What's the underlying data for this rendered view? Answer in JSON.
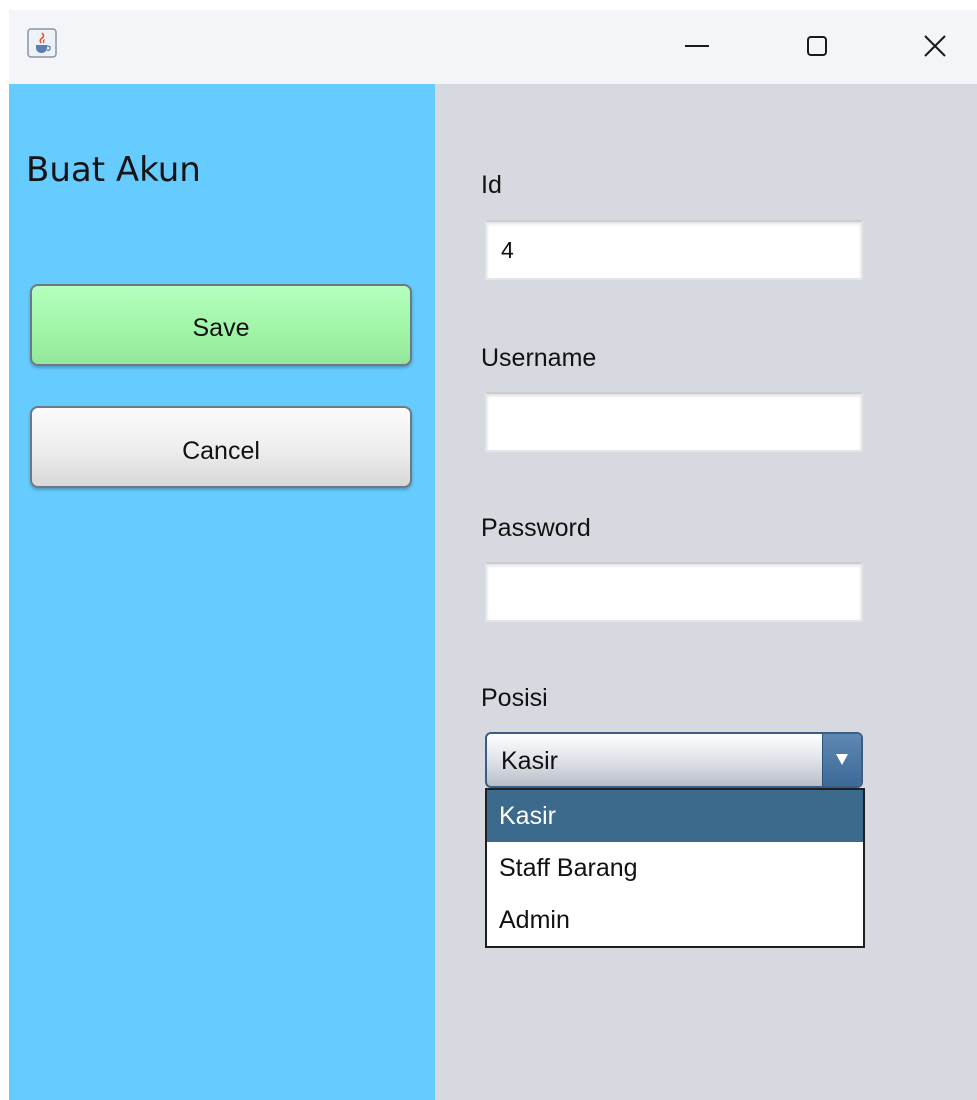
{
  "window": {
    "icons": {
      "app": "java-coffee-cup-icon",
      "minimize": "minimize-icon",
      "maximize": "maximize-icon",
      "close": "close-icon"
    }
  },
  "left_panel": {
    "title": "Buat Akun",
    "save_label": "Save",
    "cancel_label": "Cancel",
    "colors": {
      "background": "#66ccff",
      "save_button": "#a6f7ad"
    }
  },
  "form": {
    "id_label": "Id",
    "id_value": "4",
    "username_label": "Username",
    "username_value": "",
    "password_label": "Password",
    "password_value": "",
    "posisi_label": "Posisi",
    "posisi_selected": "Kasir",
    "posisi_options": [
      "Kasir",
      "Staff Barang",
      "Admin"
    ],
    "colors": {
      "background": "#d6d9e0",
      "selection": "#3c6a8c"
    }
  }
}
